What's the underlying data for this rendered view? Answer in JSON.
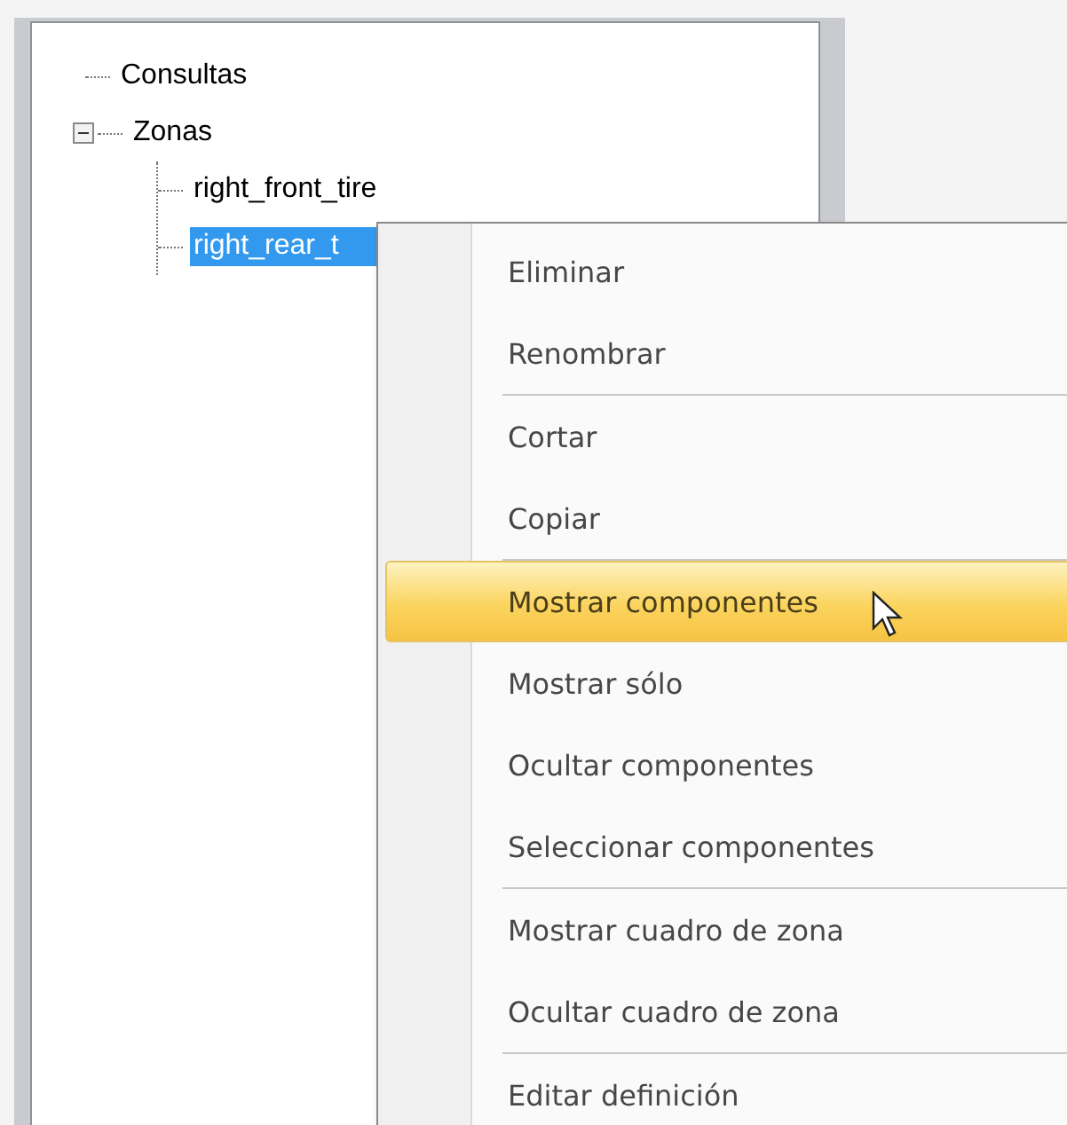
{
  "tree": [
    {
      "label": "Consultas",
      "selected": false
    },
    {
      "label": "Zonas",
      "expanded": true,
      "selected": false,
      "children": [
        {
          "label": "right_front_tire",
          "selected": false
        },
        {
          "label": "right_rear_t",
          "selected": true
        }
      ]
    }
  ],
  "context_menu": {
    "items": [
      {
        "label": "Eliminar",
        "highlighted": false
      },
      {
        "label": "Renombrar",
        "highlighted": false
      },
      {
        "kind": "separator"
      },
      {
        "label": "Cortar",
        "highlighted": false
      },
      {
        "label": "Copiar",
        "highlighted": false
      },
      {
        "kind": "separator"
      },
      {
        "label": "Mostrar componentes",
        "highlighted": true
      },
      {
        "label": "Mostrar sólo",
        "highlighted": false
      },
      {
        "label": "Ocultar componentes",
        "highlighted": false
      },
      {
        "label": "Seleccionar componentes",
        "highlighted": false
      },
      {
        "kind": "separator"
      },
      {
        "label": "Mostrar cuadro de zona",
        "highlighted": false
      },
      {
        "label": "Ocultar cuadro de zona",
        "highlighted": false
      },
      {
        "kind": "separator"
      },
      {
        "label": "Editar definición",
        "highlighted": false
      }
    ]
  }
}
